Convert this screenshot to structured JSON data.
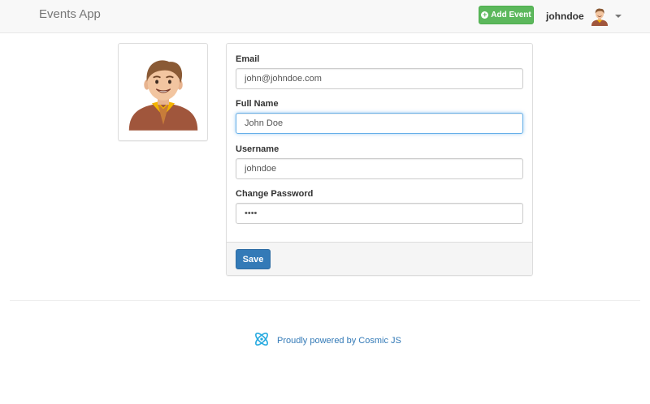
{
  "navbar": {
    "brand": "Events App",
    "add_event_label": "Add Event",
    "add_event_icon": "plus-circle-icon",
    "username": "johndoe",
    "avatar_icon": "user-avatar-icon",
    "menu_icon": "caret-down-icon"
  },
  "profile": {
    "avatar_icon": "user-avatar-icon"
  },
  "form": {
    "email": {
      "label": "Email",
      "value": "john@johndoe.com"
    },
    "full_name": {
      "label": "Full Name",
      "value": "John Doe"
    },
    "username": {
      "label": "Username",
      "value": "johndoe"
    },
    "password": {
      "label": "Change Password",
      "value": "••••"
    },
    "save_label": "Save"
  },
  "footer": {
    "powered_text": "Proudly powered by Cosmic JS",
    "logo_icon": "cosmic-js-logo-icon"
  },
  "colors": {
    "success": "#5cb85c",
    "primary": "#337ab7",
    "link": "#337ab7",
    "focus": "#66afe9"
  }
}
